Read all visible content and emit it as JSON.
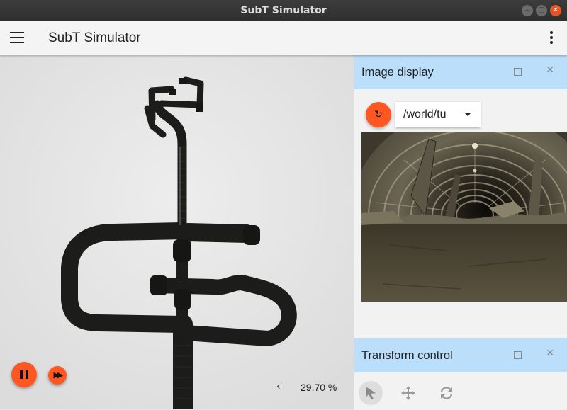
{
  "window": {
    "title": "SubT Simulator"
  },
  "window_buttons": {
    "minimize": "–",
    "maximize": "□",
    "close": "✕"
  },
  "appbar": {
    "title": "SubT Simulator",
    "menu_icon": "hamburger-menu-icon",
    "more_icon": "more-vertical-icon"
  },
  "scene": {
    "controls": {
      "pause_icon": "pause-icon",
      "step_icon": "fast-forward-icon",
      "step_glyph": "▶▶"
    },
    "real_time_factor": {
      "arrow": "‹",
      "value": "29.70 %"
    }
  },
  "image_display": {
    "title": "Image display",
    "maximize_icon": "maximize-icon",
    "close_glyph": "✕",
    "refresh_glyph": "↻",
    "topic": "/world/tu",
    "accent": "#ff5722",
    "header_color": "#bbdefb"
  },
  "transform_control": {
    "title": "Transform control",
    "close_glyph": "✕",
    "tools": [
      "select-icon",
      "translate-icon",
      "rotate-icon"
    ]
  }
}
